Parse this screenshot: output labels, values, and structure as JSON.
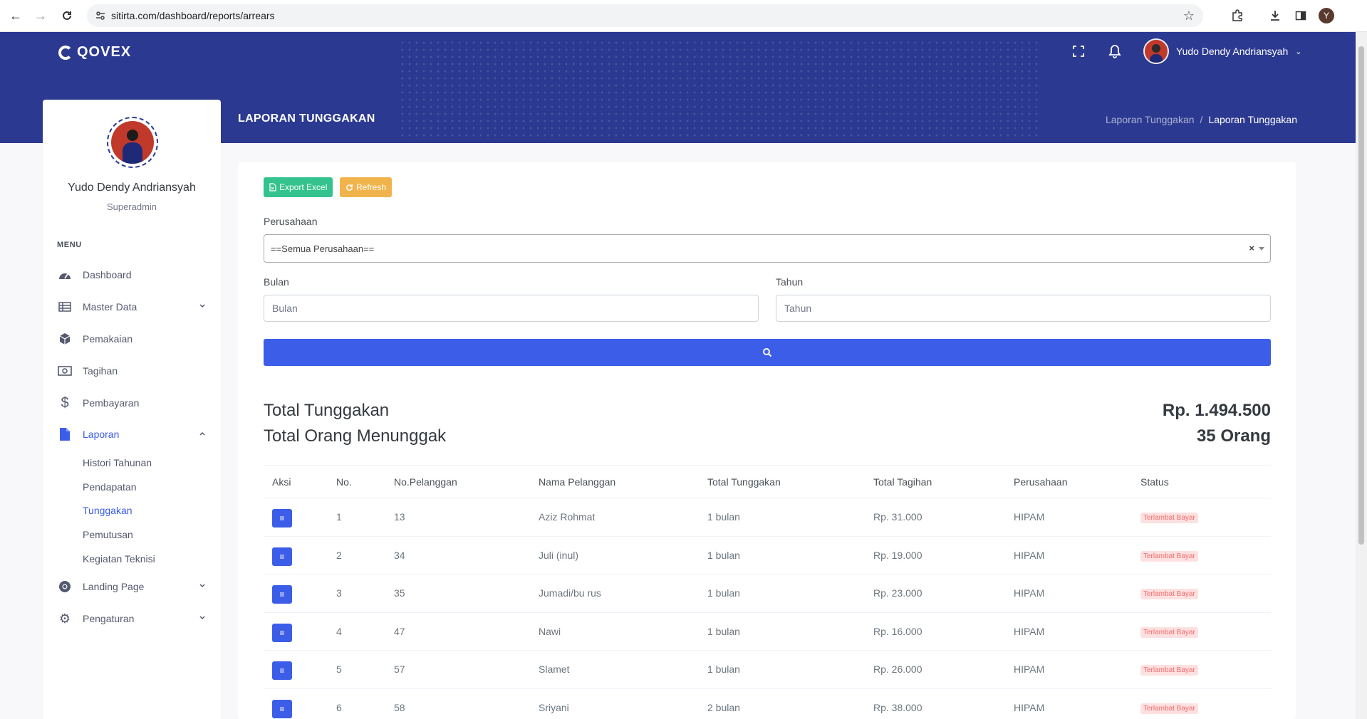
{
  "browser": {
    "url": "sitirta.com/dashboard/reports/arrears",
    "profile_initial": "Y"
  },
  "header": {
    "logo_text": "QOVEX",
    "user_name": "Yudo Dendy Andriansyah"
  },
  "page": {
    "title": "LAPORAN TUNGGAKAN",
    "breadcrumb": [
      "Laporan Tunggakan",
      "/",
      "Laporan Tunggakan"
    ]
  },
  "sidebar": {
    "profile_name": "Yudo Dendy Andriansyah",
    "profile_role": "Superadmin",
    "menu_title": "MENU",
    "items": [
      {
        "label": "Dashboard",
        "icon": "dashboard-icon"
      },
      {
        "label": "Master Data",
        "icon": "table-icon"
      },
      {
        "label": "Pemakaian",
        "icon": "box-icon"
      },
      {
        "label": "Tagihan",
        "icon": "money-icon"
      },
      {
        "label": "Pembayaran",
        "icon": "dollar-icon"
      },
      {
        "label": "Laporan",
        "icon": "file-icon"
      },
      {
        "label": "Landing Page",
        "icon": "chrome-icon"
      },
      {
        "label": "Pengaturan",
        "icon": "gear-icon"
      }
    ],
    "laporan_sub": [
      "Histori Tahunan",
      "Pendapatan",
      "Tunggakan",
      "Pemutusan",
      "Kegiatan Teknisi"
    ]
  },
  "toolbar": {
    "export_label": "Export Excel",
    "refresh_label": "Refresh"
  },
  "filters": {
    "perusahaan_label": "Perusahaan",
    "perusahaan_value": "==Semua Perusahaan==",
    "bulan_label": "Bulan",
    "bulan_placeholder": "Bulan",
    "tahun_label": "Tahun",
    "tahun_placeholder": "Tahun"
  },
  "summary": {
    "total_tunggakan_label": "Total Tunggakan",
    "total_tunggakan_value": "Rp. 1.494.500",
    "total_orang_label": "Total Orang Menunggak",
    "total_orang_value": "35 Orang"
  },
  "table": {
    "headers": [
      "Aksi",
      "No.",
      "No.Pelanggan",
      "Nama Pelanggan",
      "Total Tunggakan",
      "Total Tagihan",
      "Perusahaan",
      "Status"
    ],
    "rows": [
      {
        "no": "1",
        "pelanggan": "13",
        "nama": "Aziz Rohmat",
        "tunggakan": "1 bulan",
        "tagihan": "Rp. 31.000",
        "perusahaan": "HIPAM",
        "status": "Terlambat Bayar"
      },
      {
        "no": "2",
        "pelanggan": "34",
        "nama": "Juli (inul)",
        "tunggakan": "1 bulan",
        "tagihan": "Rp. 19.000",
        "perusahaan": "HIPAM",
        "status": "Terlambat Bayar"
      },
      {
        "no": "3",
        "pelanggan": "35",
        "nama": "Jumadi/bu rus",
        "tunggakan": "1 bulan",
        "tagihan": "Rp. 23.000",
        "perusahaan": "HIPAM",
        "status": "Terlambat Bayar"
      },
      {
        "no": "4",
        "pelanggan": "47",
        "nama": "Nawi",
        "tunggakan": "1 bulan",
        "tagihan": "Rp. 16.000",
        "perusahaan": "HIPAM",
        "status": "Terlambat Bayar"
      },
      {
        "no": "5",
        "pelanggan": "57",
        "nama": "Slamet",
        "tunggakan": "1 bulan",
        "tagihan": "Rp. 26.000",
        "perusahaan": "HIPAM",
        "status": "Terlambat Bayar"
      },
      {
        "no": "6",
        "pelanggan": "58",
        "nama": "Sriyani",
        "tunggakan": "2 bulan",
        "tagihan": "Rp. 38.000",
        "perusahaan": "HIPAM",
        "status": "Terlambat Bayar"
      }
    ]
  },
  "colors": {
    "header_bg": "#2b3990",
    "primary": "#3b5de7",
    "success": "#34c38f",
    "warning": "#f1b44c",
    "danger": "#f46a6a"
  }
}
